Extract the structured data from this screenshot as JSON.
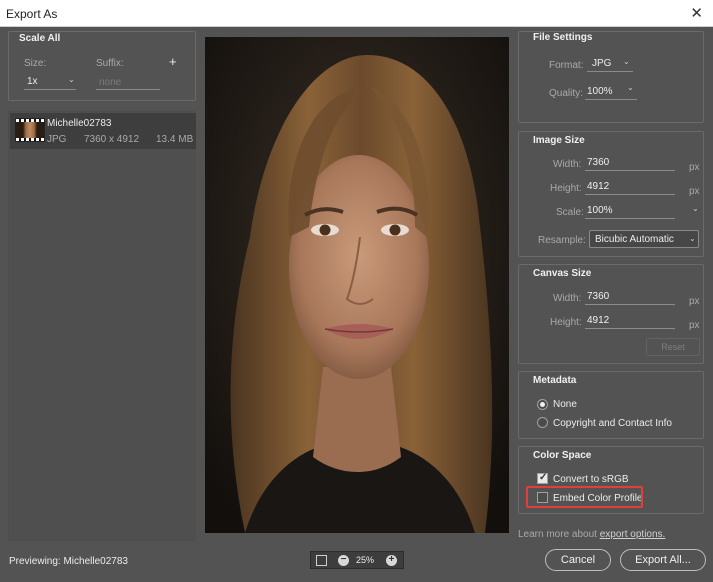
{
  "window": {
    "title": "Export As",
    "close_glyph": "✕"
  },
  "scale_all": {
    "title": "Scale All",
    "size_label": "Size:",
    "suffix_label": "Suffix:",
    "add_glyph": "+",
    "size_value": "1x",
    "suffix_placeholder": "none"
  },
  "file_list": [
    {
      "name": "Michelle02783",
      "format": "JPG",
      "dimensions": "7360 x 4912",
      "size": "13.4 MB"
    }
  ],
  "file_settings": {
    "title": "File Settings",
    "format_label": "Format:",
    "format_value": "JPG",
    "quality_label": "Quality:",
    "quality_value": "100%"
  },
  "image_size": {
    "title": "Image Size",
    "width_label": "Width:",
    "width_value": "7360",
    "height_label": "Height:",
    "height_value": "4912",
    "scale_label": "Scale:",
    "scale_value": "100%",
    "resample_label": "Resample:",
    "resample_value": "Bicubic Automatic",
    "unit": "px"
  },
  "canvas_size": {
    "title": "Canvas Size",
    "width_label": "Width:",
    "width_value": "7360",
    "height_label": "Height:",
    "height_value": "4912",
    "unit": "px",
    "reset_label": "Reset"
  },
  "metadata": {
    "title": "Metadata",
    "options": [
      "None",
      "Copyright and Contact Info"
    ],
    "selected": "None"
  },
  "color_space": {
    "title": "Color Space",
    "convert_label": "Convert to sRGB",
    "convert_checked": true,
    "embed_label": "Embed Color Profile",
    "embed_checked": false
  },
  "footer": {
    "learn_more_prefix": "Learn more about",
    "learn_more_link": "export options.",
    "previewing": "Previewing: Michelle02783",
    "zoom": "25%",
    "cancel_label": "Cancel",
    "export_label": "Export All..."
  },
  "colors": {
    "background": "#535353",
    "highlight": "#e0403c",
    "titlebar": "#ffffff"
  }
}
